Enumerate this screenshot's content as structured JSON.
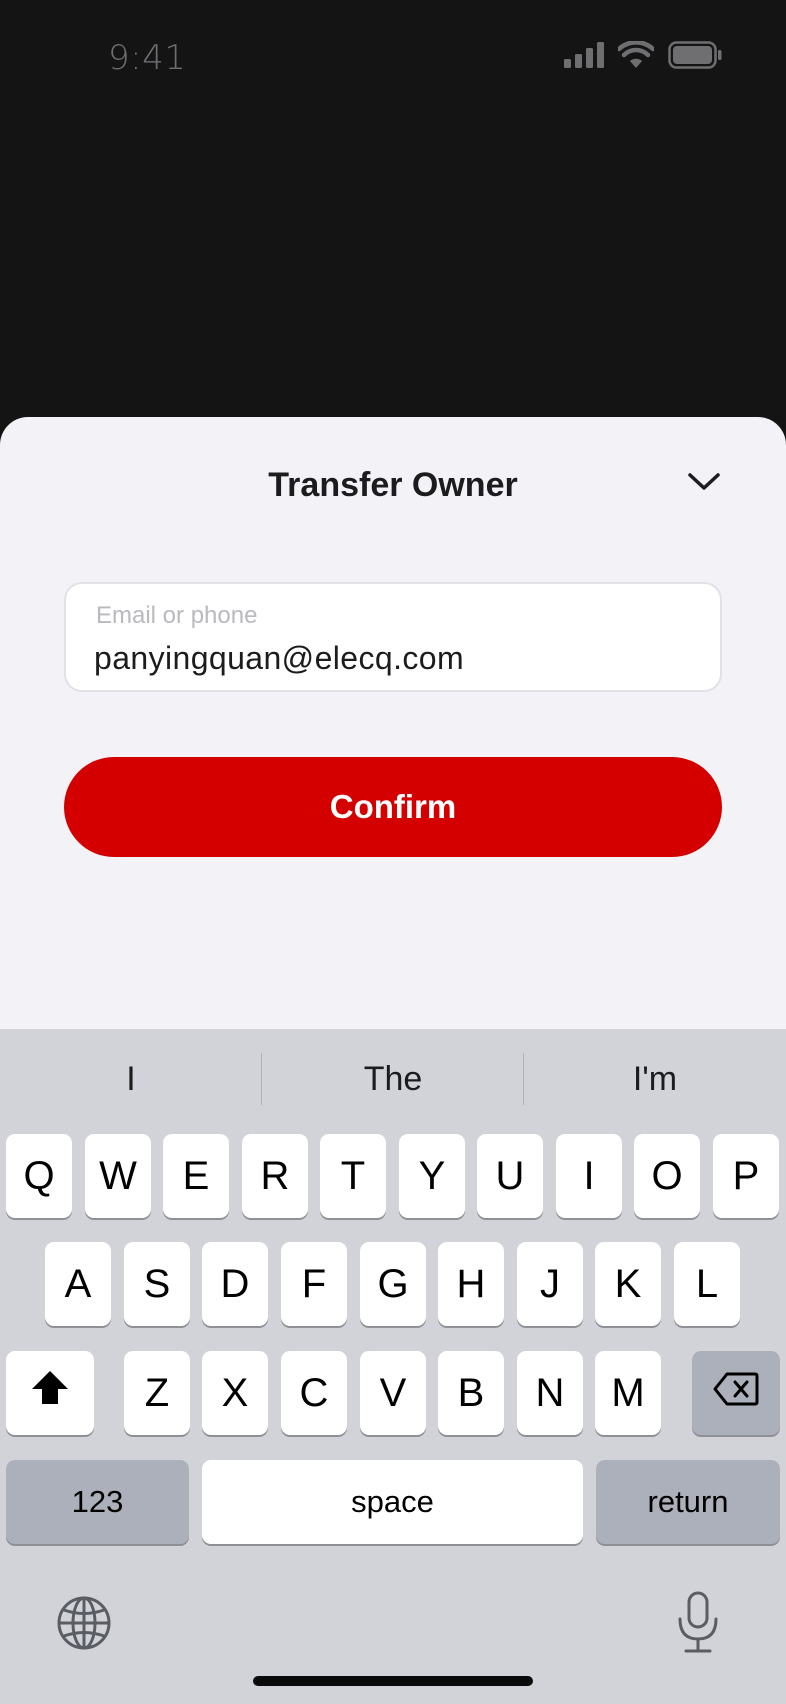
{
  "status_bar": {
    "time": "9:41",
    "icons": [
      "cellular-signal-icon",
      "wifi-icon",
      "battery-icon"
    ]
  },
  "sheet": {
    "title": "Transfer Owner",
    "collapse_icon": "chevron-down-icon",
    "field": {
      "label": "Email or phone",
      "value": "panyingquan@elecq.com"
    },
    "confirm_label": "Confirm"
  },
  "keyboard": {
    "suggestions": [
      "I",
      "The",
      "I'm"
    ],
    "row1": [
      "Q",
      "W",
      "E",
      "R",
      "T",
      "Y",
      "U",
      "I",
      "O",
      "P"
    ],
    "row2": [
      "A",
      "S",
      "D",
      "F",
      "G",
      "H",
      "J",
      "K",
      "L"
    ],
    "row3": [
      "Z",
      "X",
      "C",
      "V",
      "B",
      "N",
      "M"
    ],
    "numbers_label": "123",
    "space_label": "space",
    "return_label": "return"
  },
  "colors": {
    "accent": "#d40000",
    "sheet_bg": "#f2f2f7",
    "keyboard_bg": "#d1d3d9",
    "background": "#141415"
  }
}
